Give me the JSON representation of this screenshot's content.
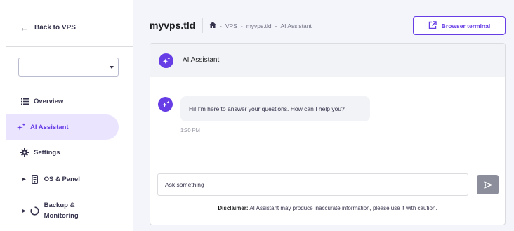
{
  "sidebar": {
    "back_label": "Back to VPS",
    "select_value": "",
    "items": [
      {
        "label": "Overview",
        "icon": "list-icon"
      },
      {
        "label": "AI Assistant",
        "icon": "sparkle-icon",
        "active": true
      },
      {
        "label": "Settings",
        "icon": "gear-icon"
      },
      {
        "label": "OS & Panel",
        "icon": "server-icon"
      },
      {
        "label_line1": "Backup &",
        "label_line2": "Monitoring",
        "icon": "backup-icon"
      }
    ]
  },
  "header": {
    "title": "myvps.tld",
    "breadcrumb": [
      "VPS",
      "myvps.tld",
      "AI Assistant"
    ],
    "breadcrumb_sep": "-",
    "terminal_button": "Browser terminal"
  },
  "chat": {
    "assistant_name": "AI Assistant",
    "messages": [
      {
        "text": "Hi! I'm here to answer your questions. How can I help you?",
        "time": "1:30 PM"
      }
    ],
    "input_placeholder": "Ask something",
    "disclaimer_bold": "Disclaimer:",
    "disclaimer_text": " AI Assistant may produce inaccurate information, please use it with caution."
  },
  "colors": {
    "accent": "#673de6",
    "active_bg": "#ebe4ff",
    "text_dark": "#36344d",
    "send_disabled": "#8c8e9c"
  }
}
